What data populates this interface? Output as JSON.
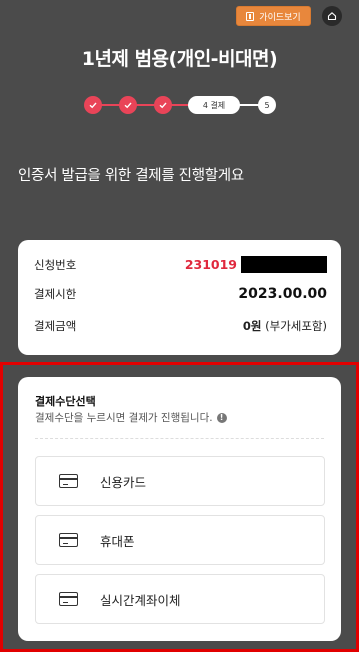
{
  "header": {
    "guide_label": "가이드보기",
    "title": "1년제 범용(개인-비대면)"
  },
  "stepper": {
    "current_label": "4 결제",
    "next_label": "5",
    "completed_steps": 3,
    "active_color": "#e94458"
  },
  "subtitle": "인증서 발급을 위한 결제를 진행할게요",
  "info": {
    "app_no_label": "신청번호",
    "app_no_value": "231019",
    "pay_time_label": "결제시한",
    "pay_time_value": "2023.00.00",
    "amount_label": "결제금액",
    "amount_value": "0원",
    "amount_note": " (부가세포함)"
  },
  "payment": {
    "title": "결제수단선택",
    "desc": "결제수단을 누르시면 결제가 진행됩니다.",
    "info_icon_glyph": "!",
    "options": [
      {
        "label": "신용카드",
        "icon": "credit-card-icon"
      },
      {
        "label": "휴대폰",
        "icon": "credit-card-icon"
      },
      {
        "label": "실시간계좌이체",
        "icon": "credit-card-icon"
      }
    ]
  },
  "colors": {
    "background": "#4b4b4b",
    "accent": "#e94458",
    "guide_button": "#e8873c",
    "highlight_border": "#e10000"
  }
}
